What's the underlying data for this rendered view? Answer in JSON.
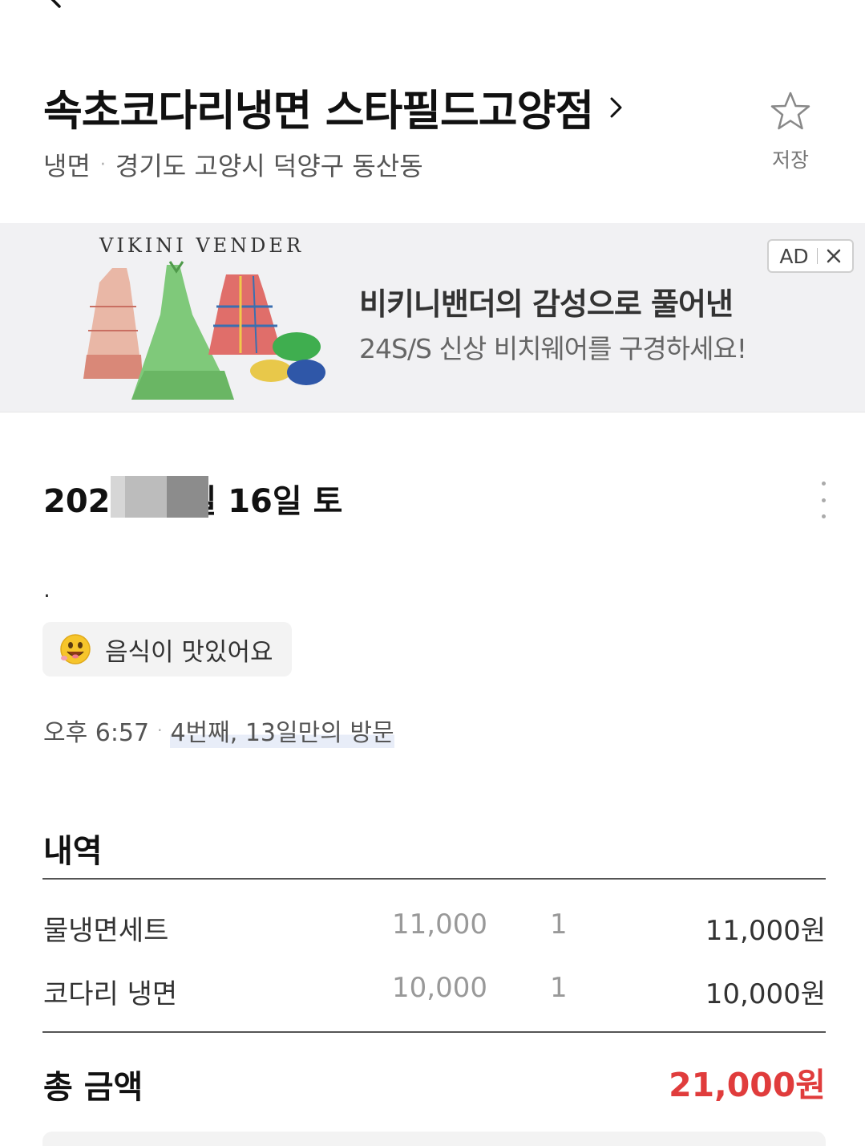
{
  "header": {
    "title": "속초코다리냉면 스타필드고양점",
    "category": "냉면",
    "address": "경기도 고양시 덕양구 동산동",
    "separator": "·",
    "save_label": "저장",
    "icons": [
      "back-arrow-icon",
      "chevron-right-icon",
      "star-outline-icon"
    ]
  },
  "ad": {
    "brand": "VIKINI VENDER",
    "headline": "비키니밴더의 감성으로 풀어낸",
    "subline": "24S/S 신상 비치웨어를 구경하세요!",
    "badge_label": "AD",
    "close_icon": "close-icon"
  },
  "visit": {
    "date_prefix": "202",
    "date_suffix": "일 16일 토",
    "review_text": ".",
    "tag_label": "음식이 맛있어요",
    "tag_icon": "smiley-icon",
    "time": "오후 6:57",
    "separator": "·",
    "visit_count": "4번째, 13일만의 방문",
    "more_icon": "more-vertical-icon"
  },
  "receipt": {
    "title": "내역",
    "items": [
      {
        "name": "물냉면세트",
        "unit_price": "11,000",
        "quantity": "1",
        "amount": "11,000원"
      },
      {
        "name": "코다리 냉면",
        "unit_price": "10,000",
        "quantity": "1",
        "amount": "10,000원"
      }
    ],
    "total_label": "총 금액",
    "total_value": "21,000원"
  },
  "colors": {
    "accent_total": "#e03c3c",
    "ad_background": "#f1f1f3",
    "chip_background": "#f3f3f3",
    "highlight": "#e8edf8"
  }
}
